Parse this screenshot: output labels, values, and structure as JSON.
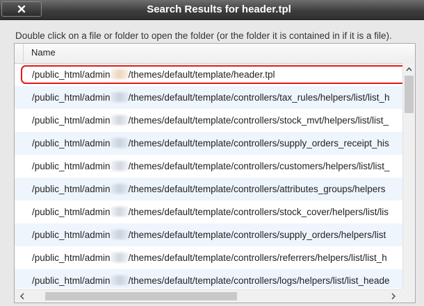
{
  "window": {
    "title": "Search Results for header.tpl",
    "close_icon": "close-icon"
  },
  "instructions": "Double click on a file or folder to open the folder (or the folder it is contained in if it is a file).",
  "list": {
    "column_header": "Name",
    "rows": [
      {
        "prefix": "/public_html/admin",
        "suffix": "/themes/default/template/header.tpl"
      },
      {
        "prefix": "/public_html/admin",
        "suffix": "/themes/default/template/controllers/tax_rules/helpers/list/list_h"
      },
      {
        "prefix": "/public_html/admin",
        "suffix": "/themes/default/template/controllers/stock_mvt/helpers/list/list_"
      },
      {
        "prefix": "/public_html/admin",
        "suffix": "/themes/default/template/controllers/supply_orders_receipt_his"
      },
      {
        "prefix": "/public_html/admin",
        "suffix": "/themes/default/template/controllers/customers/helpers/list/list_"
      },
      {
        "prefix": "/public_html/admin",
        "suffix": "/themes/default/template/controllers/attributes_groups/helpers"
      },
      {
        "prefix": "/public_html/admin",
        "suffix": "/themes/default/template/controllers/stock_cover/helpers/list/lis"
      },
      {
        "prefix": "/public_html/admin",
        "suffix": "/themes/default/template/controllers/supply_orders/helpers/list"
      },
      {
        "prefix": "/public_html/admin",
        "suffix": "/themes/default/template/controllers/referrers/helpers/list/list_h"
      },
      {
        "prefix": "/public_html/admin",
        "suffix": "/themes/default/template/controllers/logs/helpers/list/list_heade"
      }
    ],
    "highlighted_row": 0
  },
  "colors": {
    "titlebar": "#3e3e3e",
    "row_alt": "#eef5fd",
    "highlight": "#e01818"
  }
}
